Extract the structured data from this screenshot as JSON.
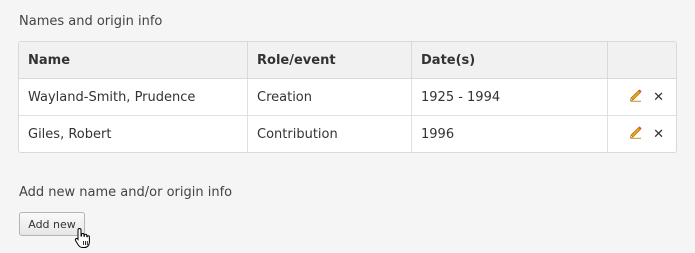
{
  "section": {
    "title": "Names and origin info"
  },
  "table": {
    "columns": [
      "Name",
      "Role/event",
      "Date(s)",
      ""
    ],
    "rows": [
      {
        "name": "Wayland-Smith, Prudence",
        "role": "Creation",
        "dates": "1925 - 1994"
      },
      {
        "name": "Giles, Robert",
        "role": "Contribution",
        "dates": "1996"
      }
    ],
    "delete_symbol": "✕"
  },
  "add": {
    "title": "Add new name and/or origin info",
    "button_label": "Add new"
  },
  "icons": {
    "edit": "pencil-icon",
    "delete": "close-icon",
    "cursor": "hand-pointer-icon"
  },
  "colors": {
    "background": "#f5f5f5",
    "header_bg": "#f1f1f1",
    "border": "#d9d9d9",
    "pencil": "#e8a317"
  }
}
